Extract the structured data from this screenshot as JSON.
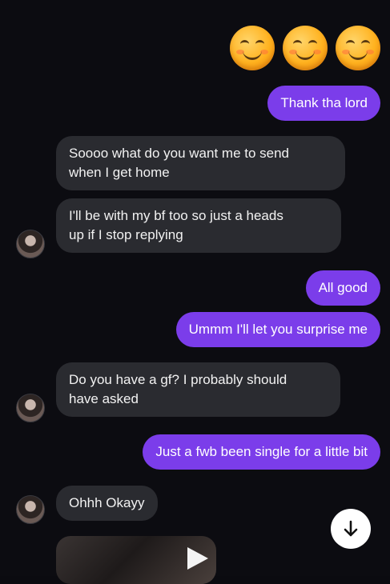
{
  "conversation": {
    "emojis": [
      "smiling-face-icon",
      "smiling-face-icon",
      "smiling-face-icon"
    ],
    "messages": [
      {
        "from": "me",
        "text": "Thank tha lord"
      },
      {
        "from": "them",
        "text": "Soooo what do you want me to send\nwhen I get home"
      },
      {
        "from": "them",
        "text": "I'll be with my bf too so just a heads\nup if I stop replying"
      },
      {
        "from": "me",
        "text": "All good"
      },
      {
        "from": "me",
        "text": "Ummm I'll let you surprise me"
      },
      {
        "from": "them",
        "text": "Do you have a gf? I probably should\nhave asked"
      },
      {
        "from": "me",
        "text": "Just a fwb been single for a little bit"
      },
      {
        "from": "them",
        "text": "Ohhh Okayy"
      }
    ]
  },
  "icons": {
    "scroll_down": "arrow-down-icon",
    "video_play": "play-icon",
    "avatar": "contact-avatar"
  },
  "colors": {
    "background": "#0c0c11",
    "outgoing_bubble": "#7b3dea",
    "incoming_bubble": "#2a2b30",
    "text": "#ffffff"
  }
}
